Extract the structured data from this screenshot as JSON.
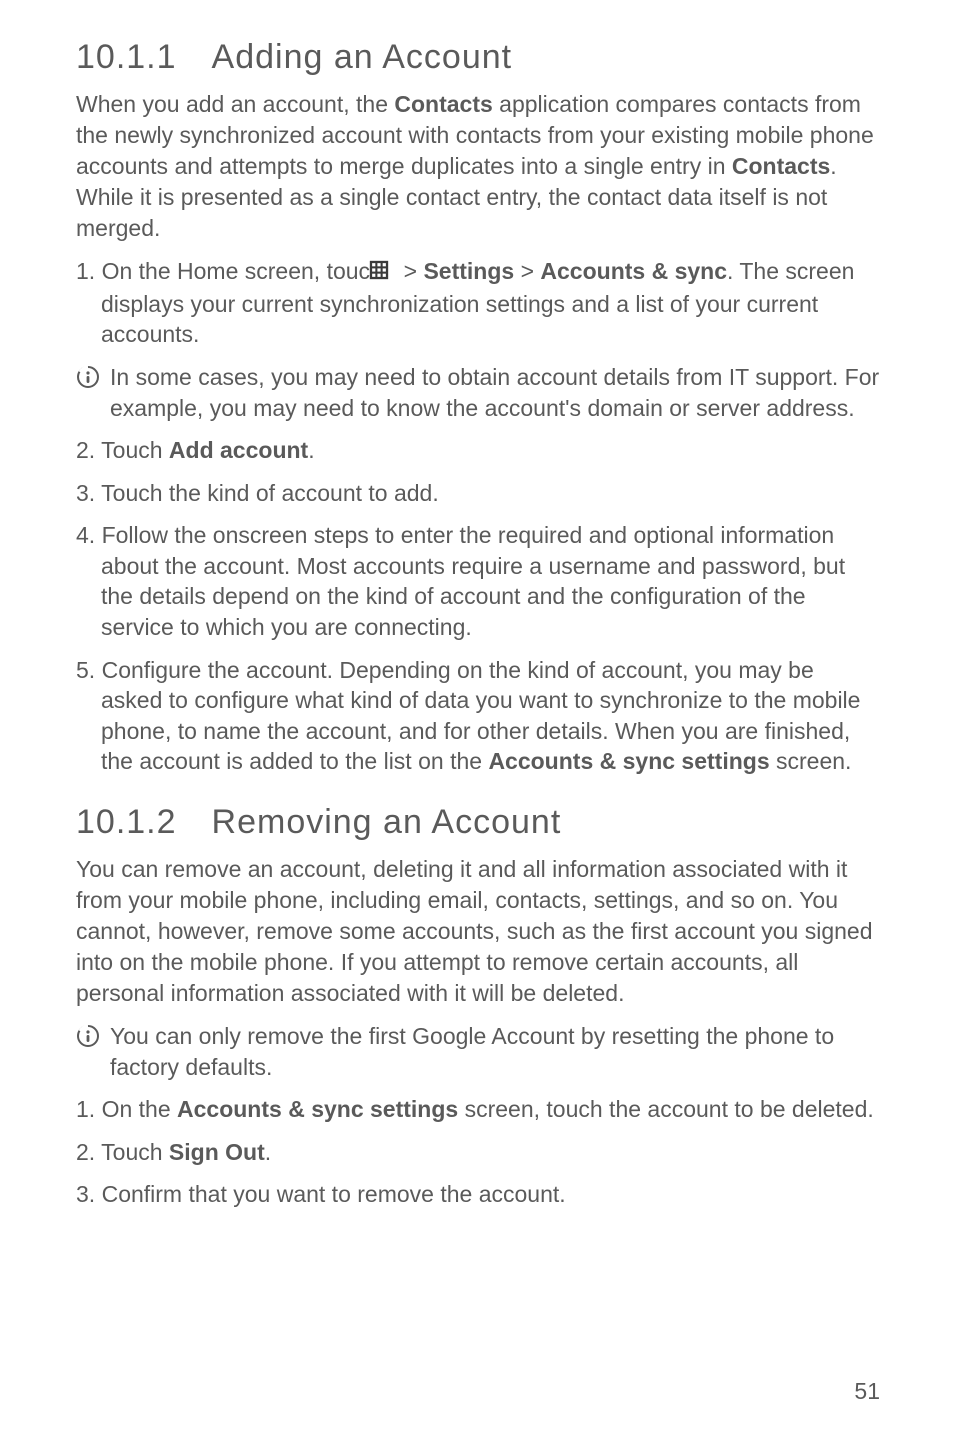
{
  "section1": {
    "heading": "10.1.1 Adding an Account",
    "intro_parts": {
      "p1": "When you add an account, the ",
      "b1": "Contacts",
      "p2": " application compares contacts from the newly synchronized account with contacts from your existing mobile phone accounts and attempts to merge duplicates into a single entry in ",
      "b2": "Contacts",
      "p3": ". While it is presented as a single contact entry, the contact data itself is not merged."
    },
    "step1": {
      "num": "1. ",
      "p1": "On the Home screen, touch ",
      "p2": " > ",
      "b1": "Settings",
      "p3": " > ",
      "b2": "Accounts & sync",
      "p4": ". The screen displays your current synchronization settings and a list of your current accounts."
    },
    "note1": "In some cases, you may need to obtain account details from IT support. For example, you may need to know the account's domain or server address.",
    "step2": {
      "num": "2. ",
      "p1": "Touch ",
      "b1": "Add account",
      "p2": "."
    },
    "step3": {
      "num": "3. ",
      "p1": "Touch the kind of account to add."
    },
    "step4": {
      "num": "4. ",
      "p1": "Follow the onscreen steps to enter the required and optional information about the account. Most accounts require a username and password, but the details depend on the kind of account and the configuration of the service to which you are connecting."
    },
    "step5": {
      "num": "5. ",
      "p1": "Configure the account. Depending on the kind of account, you may be asked to configure what kind of data you want to synchronize to the mobile phone, to name the account, and for other details. When you are finished, the account is added to the list on the ",
      "b1": "Accounts & sync settings",
      "p2": " screen."
    }
  },
  "section2": {
    "heading": "10.1.2 Removing an Account",
    "intro": "You can remove an account, deleting it and all information associated with it from your mobile phone, including email, contacts, settings, and so on. You cannot, however, remove some accounts, such as the first account you signed into on the mobile phone. If you attempt to remove certain accounts, all personal information associated with it will be deleted.",
    "note1": "You can only remove the first Google Account by resetting the phone to factory defaults.",
    "step1": {
      "num": "1. ",
      "p1": "On the ",
      "b1": "Accounts & sync settings",
      "p2": " screen, touch the account to be deleted."
    },
    "step2": {
      "num": "2. ",
      "p1": "Touch ",
      "b1": "Sign Out",
      "p2": "."
    },
    "step3": {
      "num": "3. ",
      "p1": "Confirm that you want to remove the account."
    }
  },
  "page_number": "51"
}
